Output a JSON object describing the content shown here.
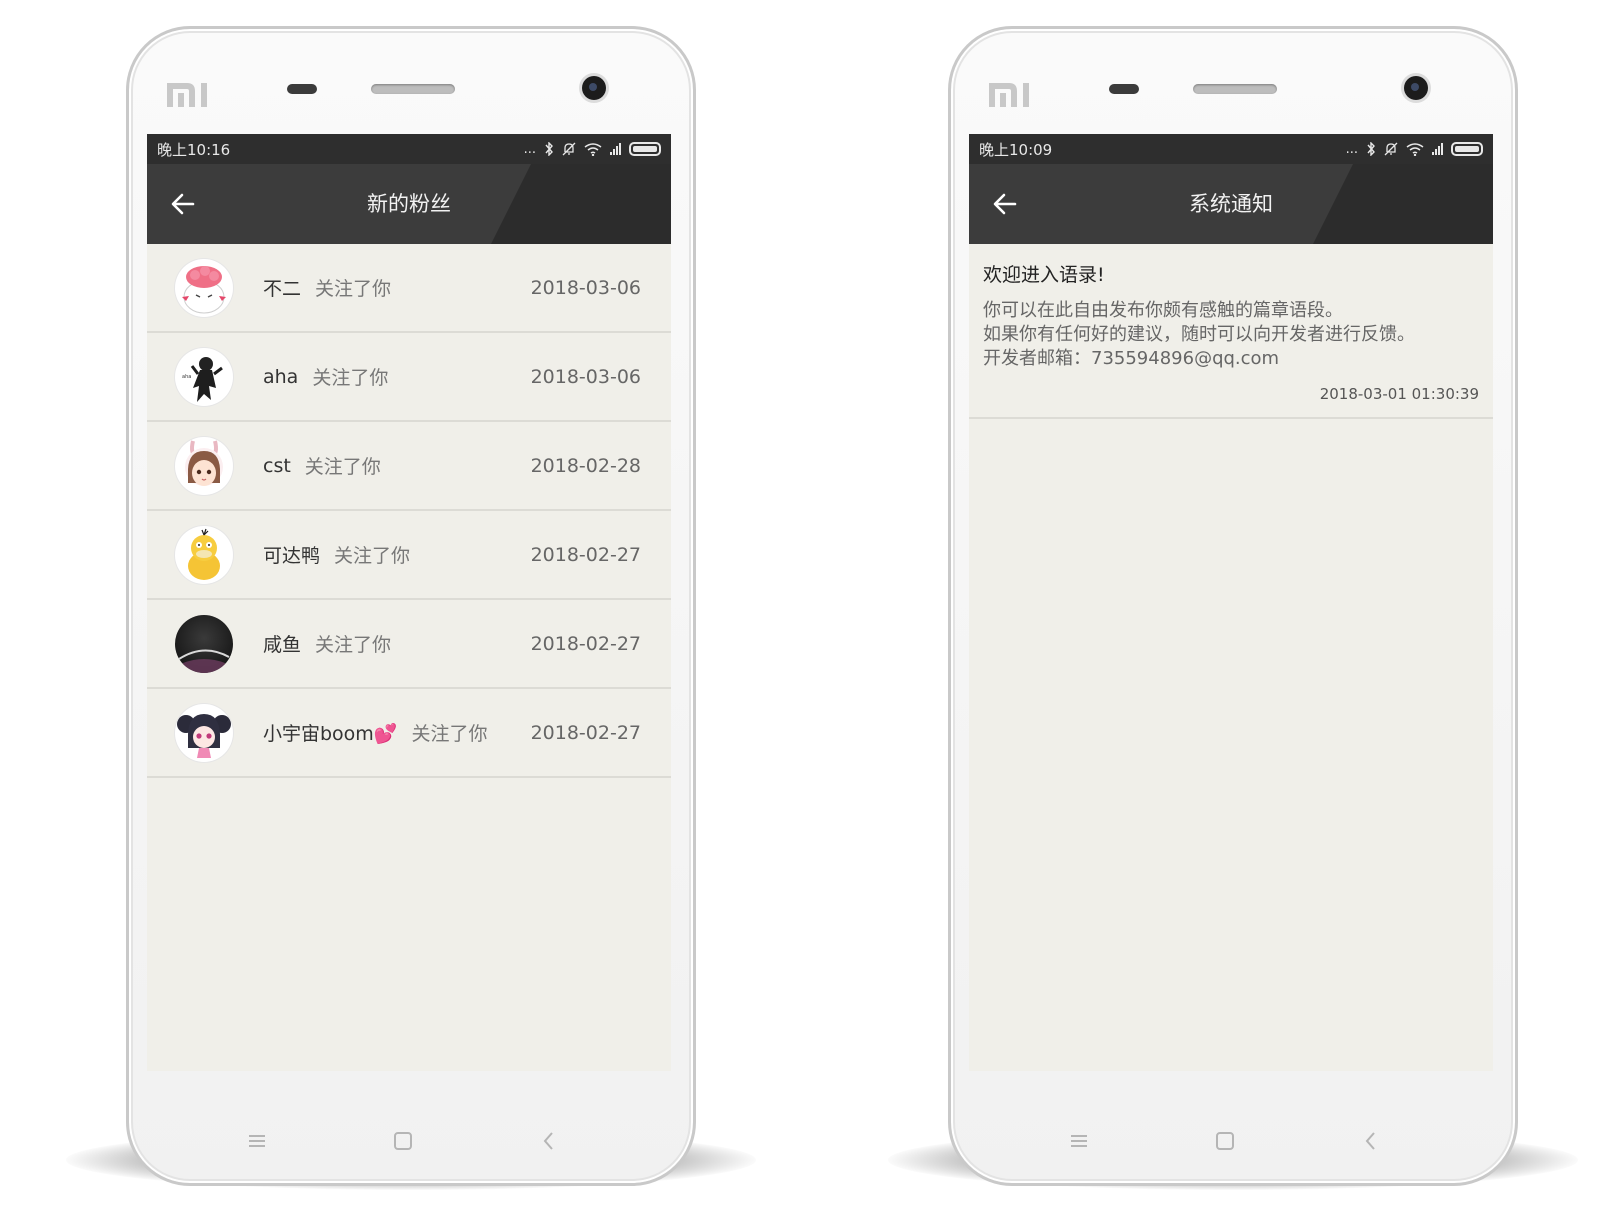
{
  "phones": [
    {
      "device": {
        "brand_logo": "mi-logo"
      },
      "status_bar": {
        "time": "晚上10:16",
        "dots": "...",
        "icons": [
          "bluetooth-icon",
          "mute-icon",
          "wifi-icon",
          "signal-icon",
          "battery-icon"
        ]
      },
      "toolbar": {
        "title": "新的粉丝",
        "back_icon": "arrow-left-icon"
      },
      "followers": [
        {
          "name": "不二",
          "action": "关注了你",
          "date": "2018-03-06",
          "avatar": "pink-brain-creature-avatar"
        },
        {
          "name": "aha",
          "action": "关注了你",
          "date": "2018-03-06",
          "avatar": "black-figure-avatar"
        },
        {
          "name": "cst",
          "action": "关注了你",
          "date": "2018-02-28",
          "avatar": "bunny-hood-girl-avatar"
        },
        {
          "name": "可达鸭",
          "action": "关注了你",
          "date": "2018-02-27",
          "avatar": "psyduck-avatar"
        },
        {
          "name": "咸鱼",
          "action": "关注了你",
          "date": "2018-02-27",
          "avatar": "dark-planet-avatar"
        },
        {
          "name": "小宇宙boom💕",
          "action": "关注了你",
          "date": "2018-02-27",
          "avatar": "anime-girl-avatar"
        }
      ],
      "nav_keys": [
        "menu-icon",
        "home-icon",
        "back-icon"
      ]
    },
    {
      "device": {
        "brand_logo": "mi-logo"
      },
      "status_bar": {
        "time": "晚上10:09",
        "dots": "...",
        "icons": [
          "bluetooth-icon",
          "mute-icon",
          "wifi-icon",
          "signal-icon",
          "battery-icon"
        ]
      },
      "toolbar": {
        "title": "系统通知",
        "back_icon": "arrow-left-icon"
      },
      "notice": {
        "title": "欢迎进入语录!",
        "lines": [
          "你可以在此自由发布你颇有感触的篇章语段。",
          "如果你有任何好的建议，随时可以向开发者进行反馈。",
          "开发者邮箱：735594896@qq.com"
        ],
        "time": "2018-03-01 01:30:39"
      },
      "nav_keys": [
        "menu-icon",
        "home-icon",
        "back-icon"
      ]
    }
  ],
  "colors": {
    "toolbar": "#3c3c3c",
    "toolbar_slant": "#2c2c2c",
    "status_bar": "#2e2e2e",
    "screen_bg": "#f0efe9",
    "divider": "#dcdbd5"
  }
}
